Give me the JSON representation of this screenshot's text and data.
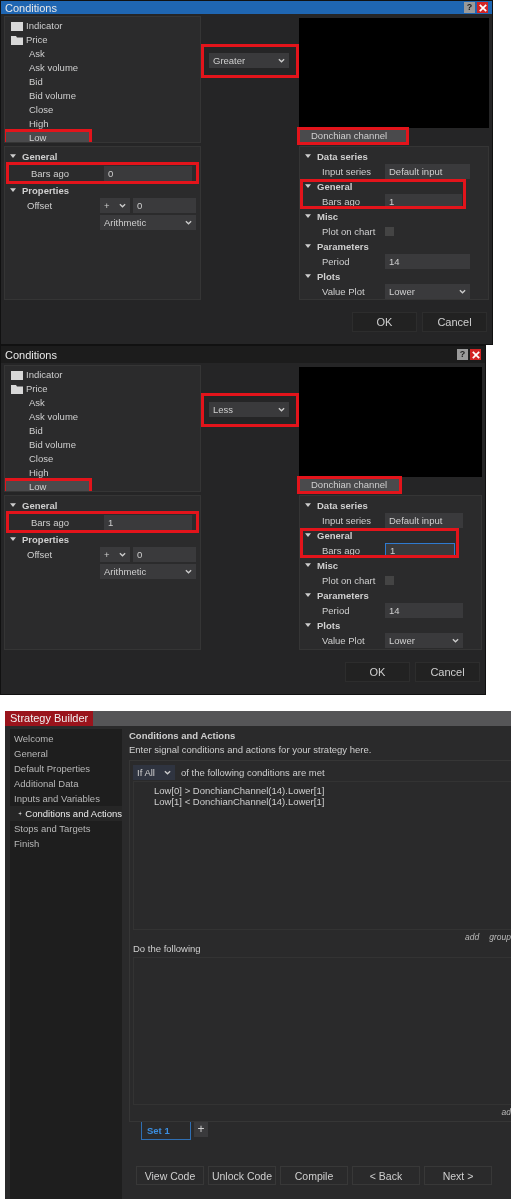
{
  "dialogs": [
    {
      "title": "Conditions",
      "active": true,
      "help": "?",
      "tree": [
        {
          "label": "Indicator",
          "kind": "indicator",
          "selected": false,
          "highlighted": false
        },
        {
          "label": "Price",
          "kind": "folder",
          "selected": false,
          "highlighted": false
        },
        {
          "label": "Ask",
          "kind": "item",
          "selected": false,
          "highlighted": false
        },
        {
          "label": "Ask volume",
          "kind": "item",
          "selected": false,
          "highlighted": false
        },
        {
          "label": "Bid",
          "kind": "item",
          "selected": false,
          "highlighted": false
        },
        {
          "label": "Bid volume",
          "kind": "item",
          "selected": false,
          "highlighted": false
        },
        {
          "label": "Close",
          "kind": "item",
          "selected": false,
          "highlighted": false
        },
        {
          "label": "High",
          "kind": "item",
          "selected": false,
          "highlighted": false
        },
        {
          "label": "Low",
          "kind": "item",
          "selected": true,
          "highlighted": true
        }
      ],
      "operator": {
        "value": "Greater",
        "highlighted": true
      },
      "indicator": {
        "label": "Donchian channel",
        "selected": true,
        "highlighted": true
      },
      "left_groups": [
        {
          "label": "General",
          "highlighted": false,
          "rows": [
            {
              "label": "Bars ago",
              "kind": "text",
              "value": "0",
              "focused": false,
              "highlighted": true
            }
          ]
        },
        {
          "label": "Properties",
          "highlighted": false,
          "rows": [
            {
              "label": "Offset",
              "kind": "offset",
              "sign": "+",
              "value": "0",
              "mode": "Arithmetic",
              "highlighted": false
            }
          ]
        }
      ],
      "right_groups": [
        {
          "label": "Data series",
          "highlighted": false,
          "rows": [
            {
              "label": "Input series",
              "kind": "text",
              "value": "Default input",
              "focused": false,
              "highlighted": false
            }
          ]
        },
        {
          "label": "General",
          "highlighted": true,
          "rows": [
            {
              "label": "Bars ago",
              "kind": "text",
              "value": "1",
              "focused": false,
              "highlighted": false
            }
          ]
        },
        {
          "label": "Misc",
          "highlighted": false,
          "rows": [
            {
              "label": "Plot on chart",
              "kind": "checkbox",
              "checked": false,
              "highlighted": false
            }
          ]
        },
        {
          "label": "Parameters",
          "highlighted": false,
          "rows": [
            {
              "label": "Period",
              "kind": "text",
              "value": "14",
              "focused": false,
              "highlighted": false
            }
          ]
        },
        {
          "label": "Plots",
          "highlighted": false,
          "rows": [
            {
              "label": "Value Plot",
              "kind": "select",
              "value": "Lower",
              "highlighted": false
            }
          ]
        }
      ],
      "buttons": [
        "OK",
        "Cancel"
      ]
    },
    {
      "title": "Conditions",
      "active": false,
      "help": "?",
      "tree": [
        {
          "label": "Indicator",
          "kind": "indicator",
          "selected": false,
          "highlighted": false
        },
        {
          "label": "Price",
          "kind": "folder",
          "selected": false,
          "highlighted": false
        },
        {
          "label": "Ask",
          "kind": "item",
          "selected": false,
          "highlighted": false
        },
        {
          "label": "Ask volume",
          "kind": "item",
          "selected": false,
          "highlighted": false
        },
        {
          "label": "Bid",
          "kind": "item",
          "selected": false,
          "highlighted": false
        },
        {
          "label": "Bid volume",
          "kind": "item",
          "selected": false,
          "highlighted": false
        },
        {
          "label": "Close",
          "kind": "item",
          "selected": false,
          "highlighted": false
        },
        {
          "label": "High",
          "kind": "item",
          "selected": false,
          "highlighted": false
        },
        {
          "label": "Low",
          "kind": "item",
          "selected": true,
          "highlighted": true
        }
      ],
      "operator": {
        "value": "Less",
        "highlighted": true
      },
      "indicator": {
        "label": "Donchian channel",
        "selected": true,
        "highlighted": true
      },
      "left_groups": [
        {
          "label": "General",
          "highlighted": false,
          "rows": [
            {
              "label": "Bars ago",
              "kind": "text",
              "value": "1",
              "focused": false,
              "highlighted": true
            }
          ]
        },
        {
          "label": "Properties",
          "highlighted": false,
          "rows": [
            {
              "label": "Offset",
              "kind": "offset",
              "sign": "+",
              "value": "0",
              "mode": "Arithmetic",
              "highlighted": false
            }
          ]
        }
      ],
      "right_groups": [
        {
          "label": "Data series",
          "highlighted": false,
          "rows": [
            {
              "label": "Input series",
              "kind": "text",
              "value": "Default input",
              "focused": false,
              "highlighted": false
            }
          ]
        },
        {
          "label": "General",
          "highlighted": true,
          "rows": [
            {
              "label": "Bars ago",
              "kind": "text",
              "value": "1",
              "focused": true,
              "highlighted": false
            }
          ]
        },
        {
          "label": "Misc",
          "highlighted": false,
          "rows": [
            {
              "label": "Plot on chart",
              "kind": "checkbox",
              "checked": false,
              "highlighted": false
            }
          ]
        },
        {
          "label": "Parameters",
          "highlighted": false,
          "rows": [
            {
              "label": "Period",
              "kind": "text",
              "value": "14",
              "focused": false,
              "highlighted": false
            }
          ]
        },
        {
          "label": "Plots",
          "highlighted": false,
          "rows": [
            {
              "label": "Value Plot",
              "kind": "select",
              "value": "Lower",
              "highlighted": false
            }
          ]
        }
      ],
      "buttons": [
        "OK",
        "Cancel"
      ]
    }
  ],
  "builder": {
    "title": "Strategy Builder",
    "nav": [
      {
        "label": "Welcome",
        "selected": false
      },
      {
        "label": "General",
        "selected": false
      },
      {
        "label": "Default Properties",
        "selected": false
      },
      {
        "label": "Additional Data",
        "selected": false
      },
      {
        "label": "Inputs and Variables",
        "selected": false
      },
      {
        "label": "Conditions and Actions",
        "selected": true
      },
      {
        "label": "Stops and Targets",
        "selected": false
      },
      {
        "label": "Finish",
        "selected": false
      }
    ],
    "heading": "Conditions and Actions",
    "subtitle": "Enter signal conditions and actions for your strategy here.",
    "match_select": "If All",
    "match_text": "of the following conditions are met",
    "conditions": [
      "Low[0] > DonchianChannel(14).Lower[1]",
      "Low[1] < DonchianChannel(14).Lower[1]"
    ],
    "condition_links": [
      "add",
      "group"
    ],
    "actions_label": "Do the following",
    "action_links": [
      "ad"
    ],
    "sets": [
      {
        "label": "Set 1",
        "selected": true
      }
    ],
    "add_set": "+",
    "buttons": [
      "View Code",
      "Unlock Code",
      "Compile",
      "< Back",
      "Next >"
    ]
  }
}
